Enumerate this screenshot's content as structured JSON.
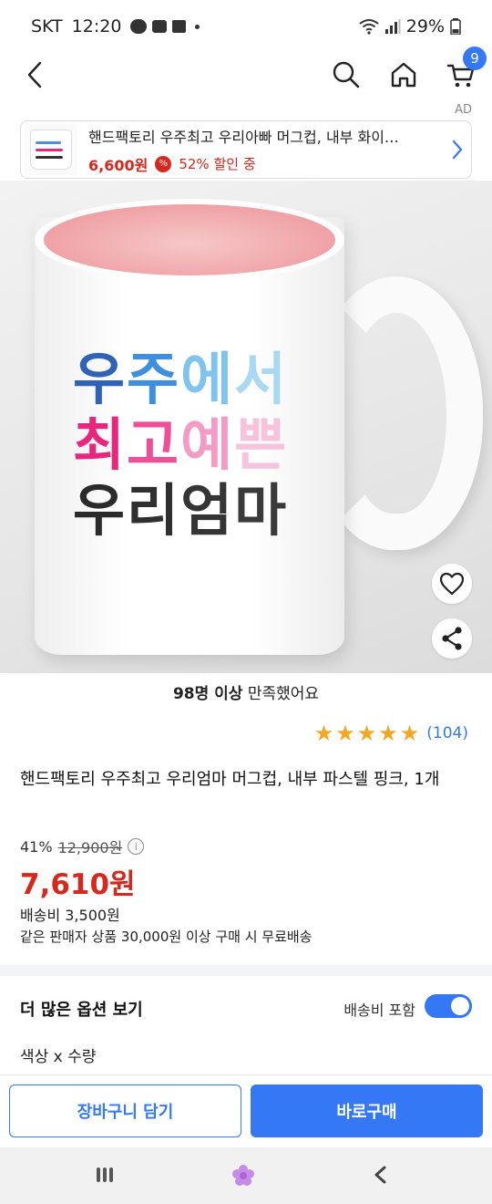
{
  "status_bar": {
    "carrier": "SKT",
    "time": "12:20",
    "battery": "29%"
  },
  "nav": {
    "cart_count": "9"
  },
  "ad": {
    "label": "AD",
    "title": "핸드팩토리 우주최고 우리아빠 머그컵, 내부 화이…",
    "price": "6,600원",
    "percent_icon": "%",
    "discount": "52% 할인 중",
    "thumb_lines": [
      "우주에서",
      "최고멋진",
      "우리아빠"
    ]
  },
  "product_image": {
    "mug_lines": [
      [
        {
          "t": "우",
          "c": "#2f63b8"
        },
        {
          "t": "주",
          "c": "#3f8fe0"
        },
        {
          "t": "에",
          "c": "#7ec4ef"
        },
        {
          "t": "서",
          "c": "#a9d8f3"
        }
      ],
      [
        {
          "t": "최",
          "c": "#e8267e"
        },
        {
          "t": "고",
          "c": "#f04f97"
        },
        {
          "t": "예",
          "c": "#f39bc4"
        },
        {
          "t": "쁜",
          "c": "#f7c2dc"
        }
      ],
      [
        {
          "t": "우",
          "c": "#2b2b2b"
        },
        {
          "t": "리",
          "c": "#2f2f2f"
        },
        {
          "t": "엄",
          "c": "#353535"
        },
        {
          "t": "마",
          "c": "#3a3a3a"
        }
      ]
    ],
    "inside_color": "#ef9fa3"
  },
  "satisfaction": {
    "count_text": "98명 이상",
    "rest_text": " 만족했어요"
  },
  "rating": {
    "stars": 5,
    "review_count": "(104)"
  },
  "product": {
    "title": "핸드팩토리 우주최고 우리엄마 머그컵, 내부 파스텔 핑크, 1개",
    "discount_rate": "41%",
    "original_price": "12,900원",
    "info_icon": "i",
    "price": "7,610원",
    "shipping_fee": "배송비 3,500원",
    "shipping_note": "같은 판매자 상품 30,000원 이상 구매 시 무료배송"
  },
  "options": {
    "title": "더 많은 옵션 보기",
    "toggle_label": "배송비 포함",
    "toggle_on": true,
    "subtitle": "색상 x 수량"
  },
  "actions": {
    "cart_label": "장바구니 담기",
    "buy_label": "바로구매"
  },
  "colors": {
    "accent": "#3478f6",
    "price_red": "#d6281c",
    "star": "#f5a623"
  }
}
